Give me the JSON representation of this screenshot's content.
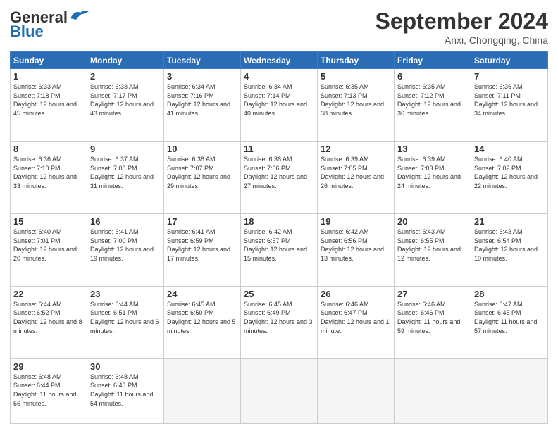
{
  "logo": {
    "line1": "General",
    "line2": "Blue"
  },
  "title": "September 2024",
  "location": "Anxi, Chongqing, China",
  "days_header": [
    "Sunday",
    "Monday",
    "Tuesday",
    "Wednesday",
    "Thursday",
    "Friday",
    "Saturday"
  ],
  "weeks": [
    [
      {
        "day": "1",
        "sunrise": "6:33 AM",
        "sunset": "7:18 PM",
        "daylight": "12 hours and 45 minutes."
      },
      {
        "day": "2",
        "sunrise": "6:33 AM",
        "sunset": "7:17 PM",
        "daylight": "12 hours and 43 minutes."
      },
      {
        "day": "3",
        "sunrise": "6:34 AM",
        "sunset": "7:16 PM",
        "daylight": "12 hours and 41 minutes."
      },
      {
        "day": "4",
        "sunrise": "6:34 AM",
        "sunset": "7:14 PM",
        "daylight": "12 hours and 40 minutes."
      },
      {
        "day": "5",
        "sunrise": "6:35 AM",
        "sunset": "7:13 PM",
        "daylight": "12 hours and 38 minutes."
      },
      {
        "day": "6",
        "sunrise": "6:35 AM",
        "sunset": "7:12 PM",
        "daylight": "12 hours and 36 minutes."
      },
      {
        "day": "7",
        "sunrise": "6:36 AM",
        "sunset": "7:11 PM",
        "daylight": "12 hours and 34 minutes."
      }
    ],
    [
      {
        "day": "8",
        "sunrise": "6:36 AM",
        "sunset": "7:10 PM",
        "daylight": "12 hours and 33 minutes."
      },
      {
        "day": "9",
        "sunrise": "6:37 AM",
        "sunset": "7:08 PM",
        "daylight": "12 hours and 31 minutes."
      },
      {
        "day": "10",
        "sunrise": "6:38 AM",
        "sunset": "7:07 PM",
        "daylight": "12 hours and 29 minutes."
      },
      {
        "day": "11",
        "sunrise": "6:38 AM",
        "sunset": "7:06 PM",
        "daylight": "12 hours and 27 minutes."
      },
      {
        "day": "12",
        "sunrise": "6:39 AM",
        "sunset": "7:05 PM",
        "daylight": "12 hours and 26 minutes."
      },
      {
        "day": "13",
        "sunrise": "6:39 AM",
        "sunset": "7:03 PM",
        "daylight": "12 hours and 24 minutes."
      },
      {
        "day": "14",
        "sunrise": "6:40 AM",
        "sunset": "7:02 PM",
        "daylight": "12 hours and 22 minutes."
      }
    ],
    [
      {
        "day": "15",
        "sunrise": "6:40 AM",
        "sunset": "7:01 PM",
        "daylight": "12 hours and 20 minutes."
      },
      {
        "day": "16",
        "sunrise": "6:41 AM",
        "sunset": "7:00 PM",
        "daylight": "12 hours and 19 minutes."
      },
      {
        "day": "17",
        "sunrise": "6:41 AM",
        "sunset": "6:59 PM",
        "daylight": "12 hours and 17 minutes."
      },
      {
        "day": "18",
        "sunrise": "6:42 AM",
        "sunset": "6:57 PM",
        "daylight": "12 hours and 15 minutes."
      },
      {
        "day": "19",
        "sunrise": "6:42 AM",
        "sunset": "6:56 PM",
        "daylight": "12 hours and 13 minutes."
      },
      {
        "day": "20",
        "sunrise": "6:43 AM",
        "sunset": "6:55 PM",
        "daylight": "12 hours and 12 minutes."
      },
      {
        "day": "21",
        "sunrise": "6:43 AM",
        "sunset": "6:54 PM",
        "daylight": "12 hours and 10 minutes."
      }
    ],
    [
      {
        "day": "22",
        "sunrise": "6:44 AM",
        "sunset": "6:52 PM",
        "daylight": "12 hours and 8 minutes."
      },
      {
        "day": "23",
        "sunrise": "6:44 AM",
        "sunset": "6:51 PM",
        "daylight": "12 hours and 6 minutes."
      },
      {
        "day": "24",
        "sunrise": "6:45 AM",
        "sunset": "6:50 PM",
        "daylight": "12 hours and 5 minutes."
      },
      {
        "day": "25",
        "sunrise": "6:45 AM",
        "sunset": "6:49 PM",
        "daylight": "12 hours and 3 minutes."
      },
      {
        "day": "26",
        "sunrise": "6:46 AM",
        "sunset": "6:47 PM",
        "daylight": "12 hours and 1 minute."
      },
      {
        "day": "27",
        "sunrise": "6:46 AM",
        "sunset": "6:46 PM",
        "daylight": "11 hours and 59 minutes."
      },
      {
        "day": "28",
        "sunrise": "6:47 AM",
        "sunset": "6:45 PM",
        "daylight": "11 hours and 57 minutes."
      }
    ],
    [
      {
        "day": "29",
        "sunrise": "6:48 AM",
        "sunset": "6:44 PM",
        "daylight": "11 hours and 56 minutes."
      },
      {
        "day": "30",
        "sunrise": "6:48 AM",
        "sunset": "6:43 PM",
        "daylight": "11 hours and 54 minutes."
      },
      null,
      null,
      null,
      null,
      null
    ]
  ]
}
